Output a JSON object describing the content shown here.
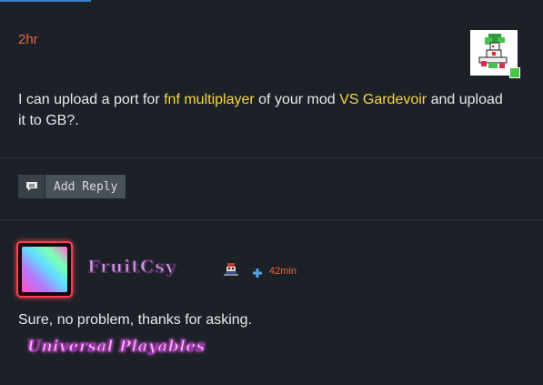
{
  "post": {
    "time": "2hr",
    "text_parts": {
      "p1": "I can upload a port for ",
      "p2": "fnf multiplayer",
      "p3": " of your mod ",
      "p4": "VS Gardevoir",
      "p5": " and upload it to GB?."
    },
    "online_status_color": "#4cc246",
    "highlight_color": "#f5d547",
    "time_color": "#e8663c"
  },
  "reply": {
    "button_label": "Add Reply",
    "icon": "comment-icon"
  },
  "comment": {
    "username": "FruitCsy",
    "time": "42min",
    "text": "Sure, no problem, thanks for asking.",
    "signature": "Universal Playables",
    "avatar_border_color": "#ff3b54",
    "flair_icon": "character-flair-icon",
    "plus_icon": "plus-icon"
  }
}
